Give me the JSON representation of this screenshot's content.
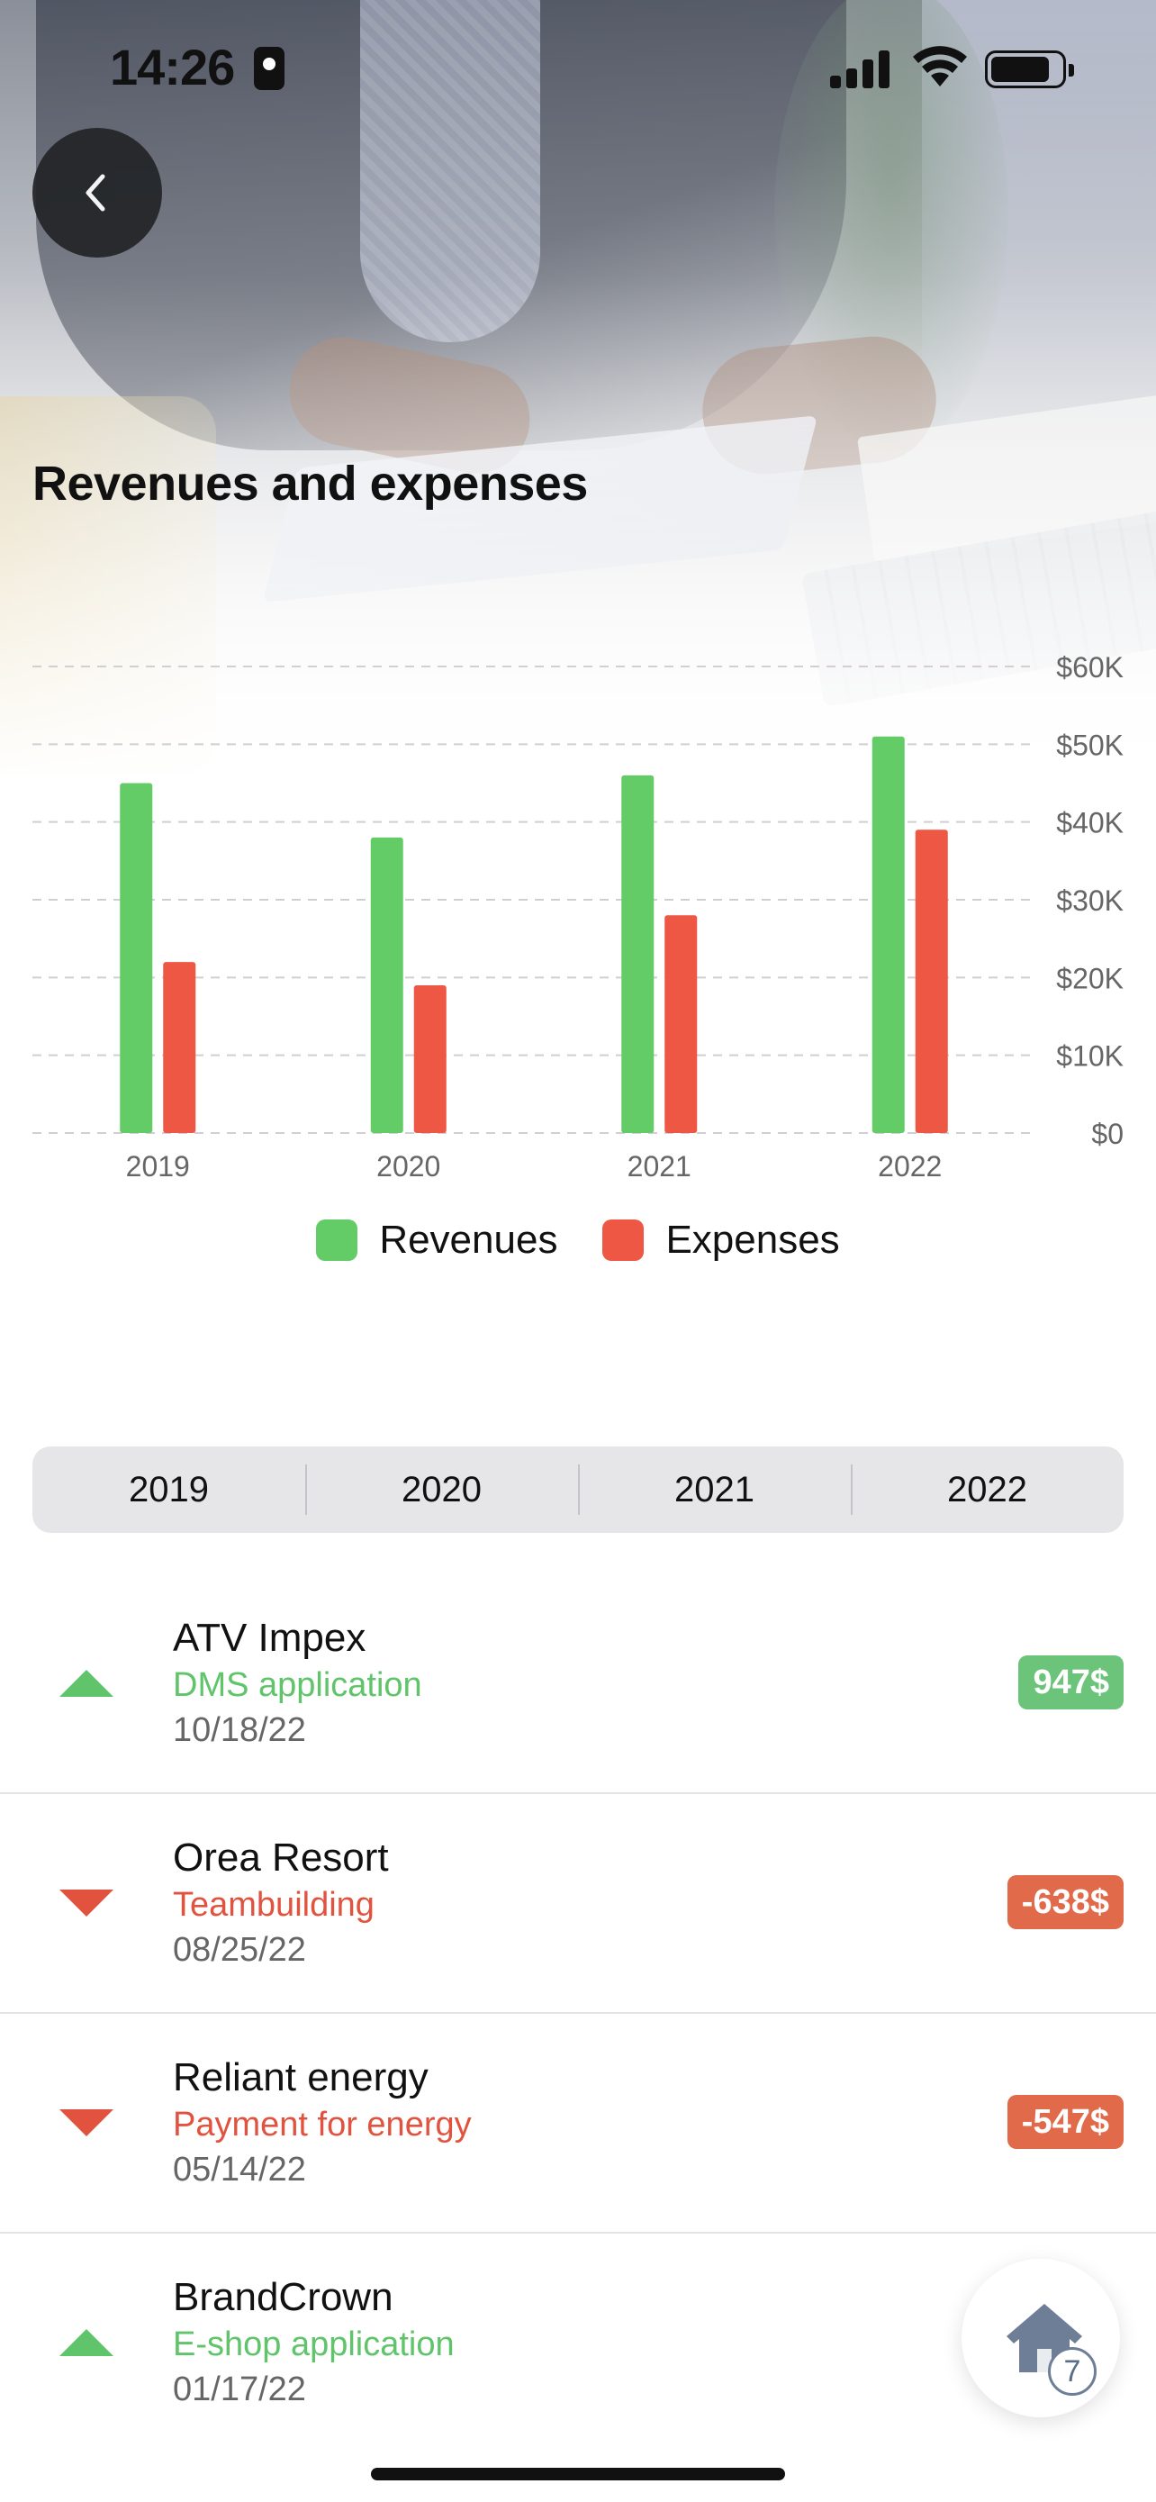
{
  "status_bar": {
    "time": "14:26"
  },
  "header": {
    "title": "Revenues and expenses"
  },
  "colors": {
    "revenue": "#63cc66",
    "expense": "#ee5744",
    "axis": "#666666"
  },
  "chart_data": {
    "type": "bar",
    "categories": [
      "2019",
      "2020",
      "2021",
      "2022"
    ],
    "series": [
      {
        "name": "Revenues",
        "values": [
          45000,
          38000,
          46000,
          51000
        ]
      },
      {
        "name": "Expenses",
        "values": [
          22000,
          19000,
          28000,
          39000
        ]
      }
    ],
    "y_ticks": [
      "$0",
      "$10K",
      "$20K",
      "$30K",
      "$40K",
      "$50K",
      "$60K"
    ],
    "ylim": [
      0,
      60000
    ],
    "grid": true,
    "legend_position": "bottom-center"
  },
  "legend": {
    "revenues": "Revenues",
    "expenses": "Expenses"
  },
  "year_tabs": [
    "2019",
    "2020",
    "2021",
    "2022"
  ],
  "transactions": [
    {
      "name": "ATV Impex",
      "description": "DMS application",
      "date": "10/18/22",
      "amount": "947$",
      "direction": "up"
    },
    {
      "name": "Orea Resort",
      "description": "Teambuilding",
      "date": "08/25/22",
      "amount": "-638$",
      "direction": "down"
    },
    {
      "name": "Reliant energy",
      "description": "Payment for energy",
      "date": "05/14/22",
      "amount": "-547$",
      "direction": "down"
    },
    {
      "name": "BrandCrown",
      "description": "E-shop application",
      "date": "01/17/22",
      "amount": "",
      "direction": "up"
    }
  ],
  "fab": {
    "icon": "home-icon",
    "count": "7"
  }
}
